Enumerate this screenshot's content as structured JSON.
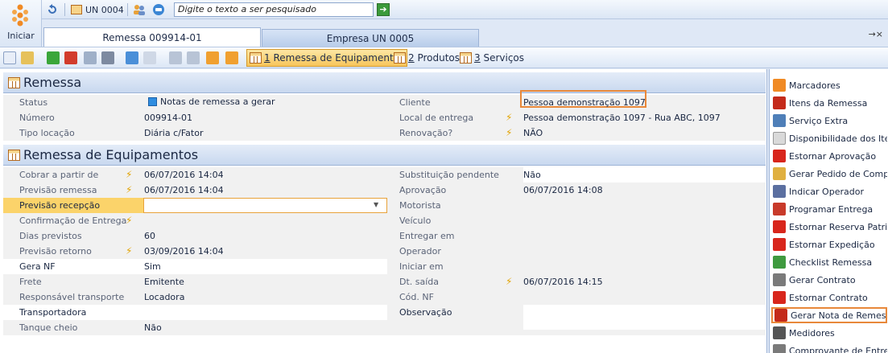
{
  "topbar": {
    "start_label": "Iniciar",
    "unit_label": "UN 0004",
    "search_placeholder": "Digite o texto a ser pesquisado"
  },
  "tabs": [
    {
      "label": "Remessa 009914-01",
      "active": true
    },
    {
      "label": "Empresa UN 0005",
      "active": false
    }
  ],
  "toolbar2": {
    "tabs": [
      {
        "num": "1",
        "label": " Remessa de Equipamentos",
        "active": true
      },
      {
        "num": "2",
        "label": " Produtos",
        "active": false
      },
      {
        "num": "3",
        "label": " Serviços",
        "active": false
      }
    ]
  },
  "remessa": {
    "title": "Remessa",
    "status_label": "Status",
    "status_value": "Notas de remessa a gerar",
    "numero_label": "Número",
    "numero_value": "009914-01",
    "tipo_label": "Tipo locação",
    "tipo_value": "Diária c/Fator",
    "cliente_label": "Cliente",
    "cliente_value": "Pessoa demonstração 1097",
    "local_label": "Local de entrega",
    "local_value": "Pessoa demonstração 1097 - Rua ABC, 1097",
    "renovacao_label": "Renovação?",
    "renovacao_value": "NÃO"
  },
  "equip": {
    "title": "Remessa de Equipamentos",
    "left": [
      {
        "label": "Cobrar a partir de",
        "value": "06/07/2016 14:04",
        "bolt": true
      },
      {
        "label": "Previsão remessa",
        "value": "06/07/2016 14:04",
        "bolt": true
      },
      {
        "label": "Previsão recepção",
        "value": "",
        "bolt": false
      },
      {
        "label": "Confirmação de Entrega",
        "value": "",
        "bolt": true
      },
      {
        "label": "Dias previstos",
        "value": "60",
        "bolt": false
      },
      {
        "label": "Previsão retorno",
        "value": "03/09/2016 14:04",
        "bolt": true
      },
      {
        "label": "Gera NF",
        "value": "Sim",
        "bolt": false
      },
      {
        "label": "Frete",
        "value": "Emitente",
        "bolt": false
      },
      {
        "label": "Responsável transporte",
        "value": "Locadora",
        "bolt": false
      },
      {
        "label": "Transportadora",
        "value": "",
        "bolt": false
      },
      {
        "label": "Tanque cheio",
        "value": "Não",
        "bolt": false
      }
    ],
    "right": [
      {
        "label": "Substituição pendente",
        "value": "Não",
        "bolt": false
      },
      {
        "label": "Aprovação",
        "value": "06/07/2016 14:08",
        "bolt": false
      },
      {
        "label": "Motorista",
        "value": "",
        "bolt": false
      },
      {
        "label": "Veículo",
        "value": "",
        "bolt": false
      },
      {
        "label": "Entregar em",
        "value": "",
        "bolt": false
      },
      {
        "label": "Operador",
        "value": "",
        "bolt": false
      },
      {
        "label": "Iniciar em",
        "value": "",
        "bolt": false
      },
      {
        "label": "Dt. saída",
        "value": "06/07/2016 14:15",
        "bolt": true
      },
      {
        "label": "Cód. NF",
        "value": "",
        "bolt": false
      },
      {
        "label": "Observação",
        "value": "",
        "bolt": false
      }
    ]
  },
  "rightpanel": [
    {
      "label": "Marcadores",
      "icon": "tag-icon",
      "color": "#f08a24"
    },
    {
      "label": "Itens da Remessa",
      "icon": "phone-icon",
      "color": "#c42a1a"
    },
    {
      "label": "Serviço Extra",
      "icon": "wrench-icon",
      "color": "#4f7fb8"
    },
    {
      "label": "Disponibilidade dos Itens",
      "icon": "document-icon",
      "color": "#d9d9d9"
    },
    {
      "label": "Estornar Aprovação",
      "icon": "undo-icon",
      "color": "#d8261c"
    },
    {
      "label": "Gerar Pedido de Compra",
      "icon": "order-icon",
      "color": "#e0b040"
    },
    {
      "label": "Indicar Operador",
      "icon": "calendar-icon",
      "color": "#5b6fa0"
    },
    {
      "label": "Programar Entrega",
      "icon": "truck-icon",
      "color": "#c83a2a"
    },
    {
      "label": "Estornar Reserva Patrim.",
      "icon": "undo-icon",
      "color": "#d8261c"
    },
    {
      "label": "Estornar Expedição",
      "icon": "undo-icon",
      "color": "#d8261c"
    },
    {
      "label": "Checklist Remessa",
      "icon": "checklist-icon",
      "color": "#3f9a3f"
    },
    {
      "label": "Gerar Contrato",
      "icon": "printer-icon",
      "color": "#7a7a7a"
    },
    {
      "label": "Estornar Contrato",
      "icon": "undo-icon",
      "color": "#d8261c"
    },
    {
      "label": "Gerar Nota de Remessa",
      "icon": "invoice-icon",
      "color": "#c42a1a"
    },
    {
      "label": "Medidores",
      "icon": "counter-icon",
      "color": "#555555"
    },
    {
      "label": "Comprovante de Entrega",
      "icon": "printer-icon",
      "color": "#7a7a7a"
    }
  ],
  "colors": {
    "highlight_orange": "#e8883a",
    "active_row": "#fbd36a"
  }
}
